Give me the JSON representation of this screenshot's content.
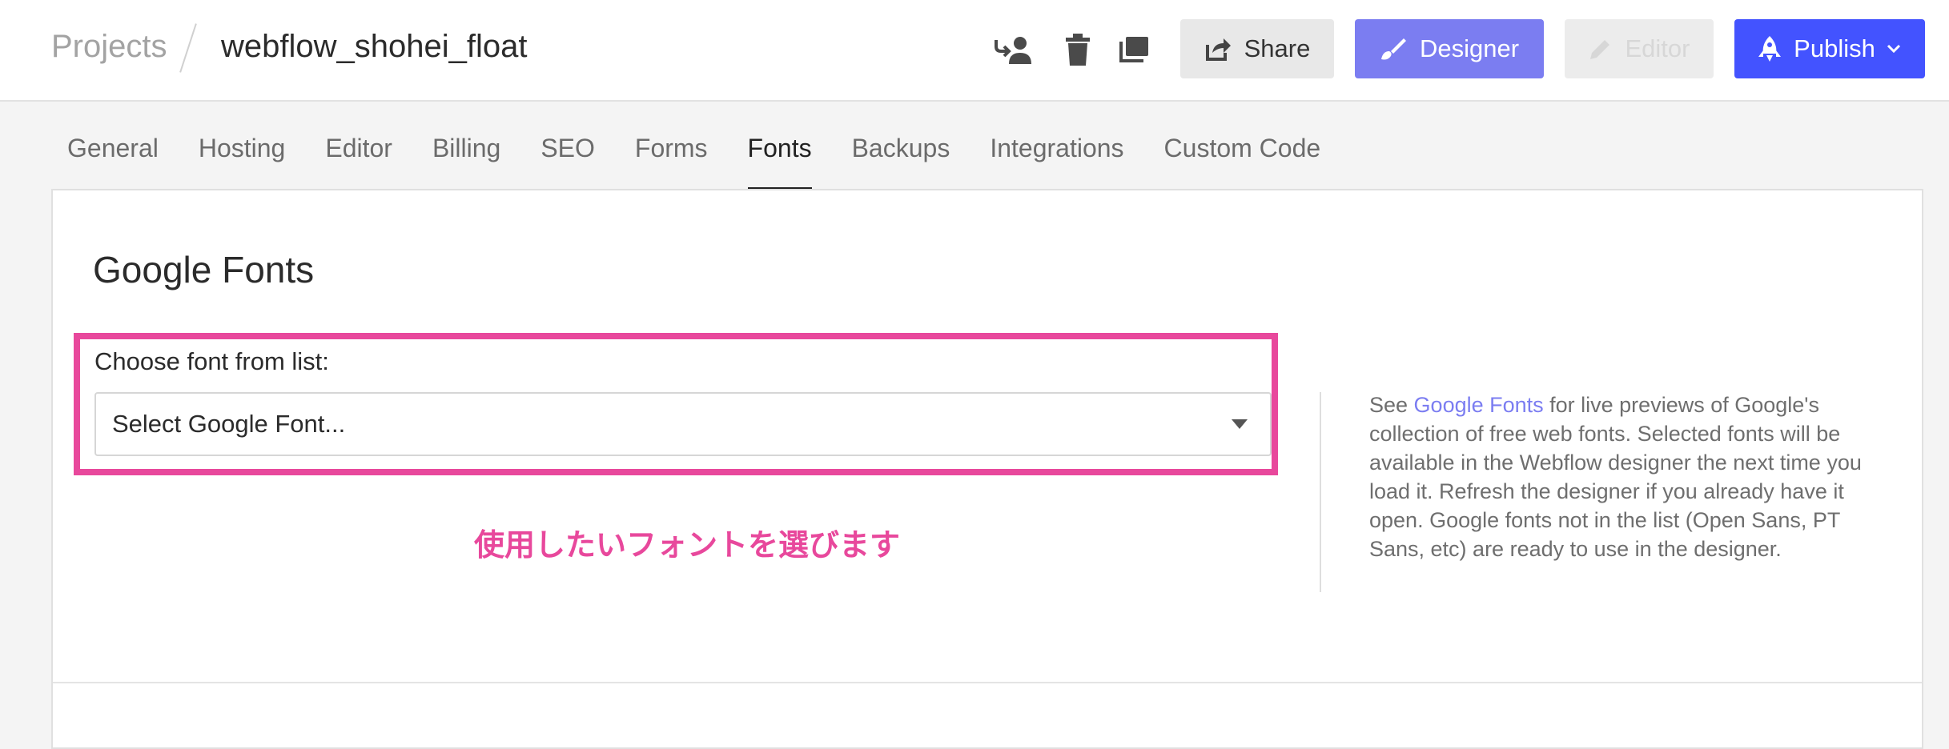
{
  "header": {
    "breadcrumb_root": "Projects",
    "project_name": "webflow_shohei_float",
    "icons": [
      "transfer-user-icon",
      "trash-icon",
      "duplicate-icon"
    ],
    "buttons": {
      "share": "Share",
      "designer": "Designer",
      "editor": "Editor",
      "publish": "Publish"
    }
  },
  "tabs": [
    {
      "label": "General",
      "active": false
    },
    {
      "label": "Hosting",
      "active": false
    },
    {
      "label": "Editor",
      "active": false
    },
    {
      "label": "Billing",
      "active": false
    },
    {
      "label": "SEO",
      "active": false
    },
    {
      "label": "Forms",
      "active": false
    },
    {
      "label": "Fonts",
      "active": true
    },
    {
      "label": "Backups",
      "active": false
    },
    {
      "label": "Integrations",
      "active": false
    },
    {
      "label": "Custom Code",
      "active": false
    }
  ],
  "fonts_section": {
    "title": "Google Fonts",
    "field_label": "Choose font from list:",
    "select_placeholder": "Select Google Font...",
    "annotation": "使用したいフォントを選びます",
    "help": {
      "prefix": "See ",
      "link_text": "Google Fonts",
      "suffix": " for live previews of Google's collection of free web fonts. Selected fonts will be available in the Webflow designer the next time you load it. Refresh the designer if you already have it open. Google fonts not in the list (Open Sans, PT Sans, etc) are ready to use in the designer."
    }
  },
  "colors": {
    "accent_designer": "#7b7df1",
    "accent_publish": "#4353ff",
    "highlight": "#e8489c"
  }
}
